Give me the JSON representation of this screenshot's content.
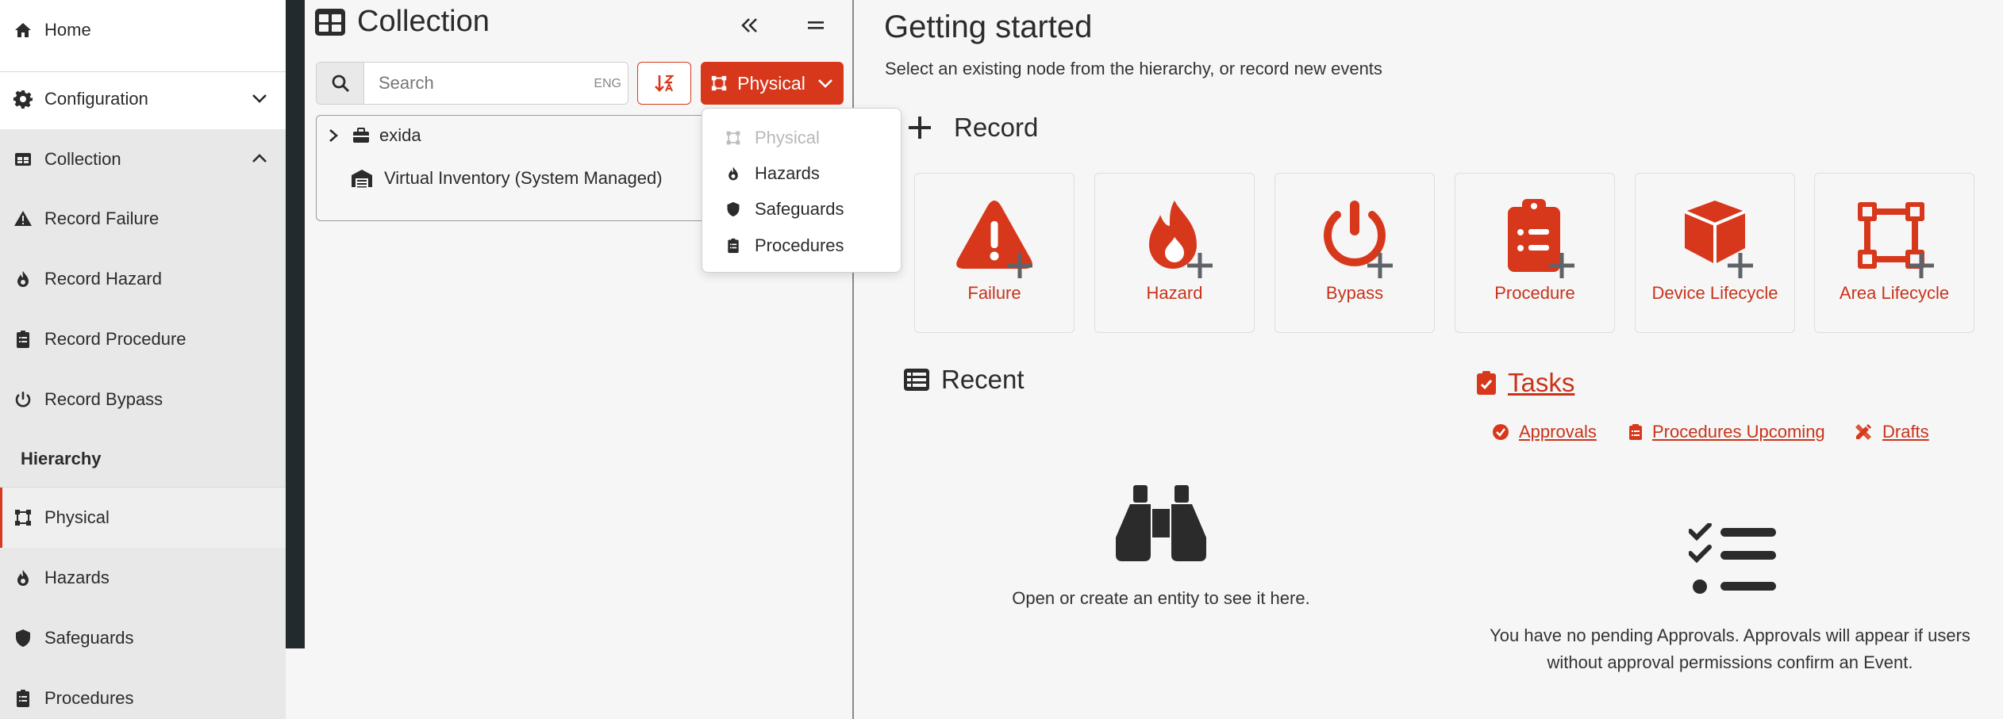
{
  "sidebar": {
    "home": "Home",
    "configuration": "Configuration",
    "collection": "Collection",
    "record_items": [
      "Record Failure",
      "Record Hazard",
      "Record Procedure",
      "Record Bypass"
    ],
    "hierarchy_heading": "Hierarchy",
    "hierarchy_items": [
      "Physical",
      "Hazards",
      "Safeguards",
      "Procedures"
    ]
  },
  "collection_panel": {
    "title": "Collection",
    "search_placeholder": "Search",
    "keyboard_hint": "ENG",
    "view_button": "Physical",
    "tree": [
      "exida",
      "Virtual Inventory (System Managed)"
    ],
    "dropdown": [
      "Physical",
      "Hazards",
      "Safeguards",
      "Procedures"
    ]
  },
  "main": {
    "title": "Getting started",
    "subtitle": "Select an existing node from the hierarchy, or record new events",
    "record_heading": "Record",
    "record_cards": [
      "Failure",
      "Hazard",
      "Bypass",
      "Procedure",
      "Device Lifecycle",
      "Area Lifecycle"
    ],
    "recent_heading": "Recent",
    "recent_empty": "Open or create an entity to see it here.",
    "tasks_heading": "Tasks",
    "task_links": [
      "Approvals",
      "Procedures Upcoming",
      "Drafts"
    ],
    "tasks_empty_line1": "You have no pending Approvals. Approvals will appear if users",
    "tasks_empty_line2": "without approval permissions confirm an Event."
  },
  "colors": {
    "accent": "#d7381c",
    "sidebar_dark": "#222a2e",
    "icon_dark": "#2b2b2b"
  }
}
